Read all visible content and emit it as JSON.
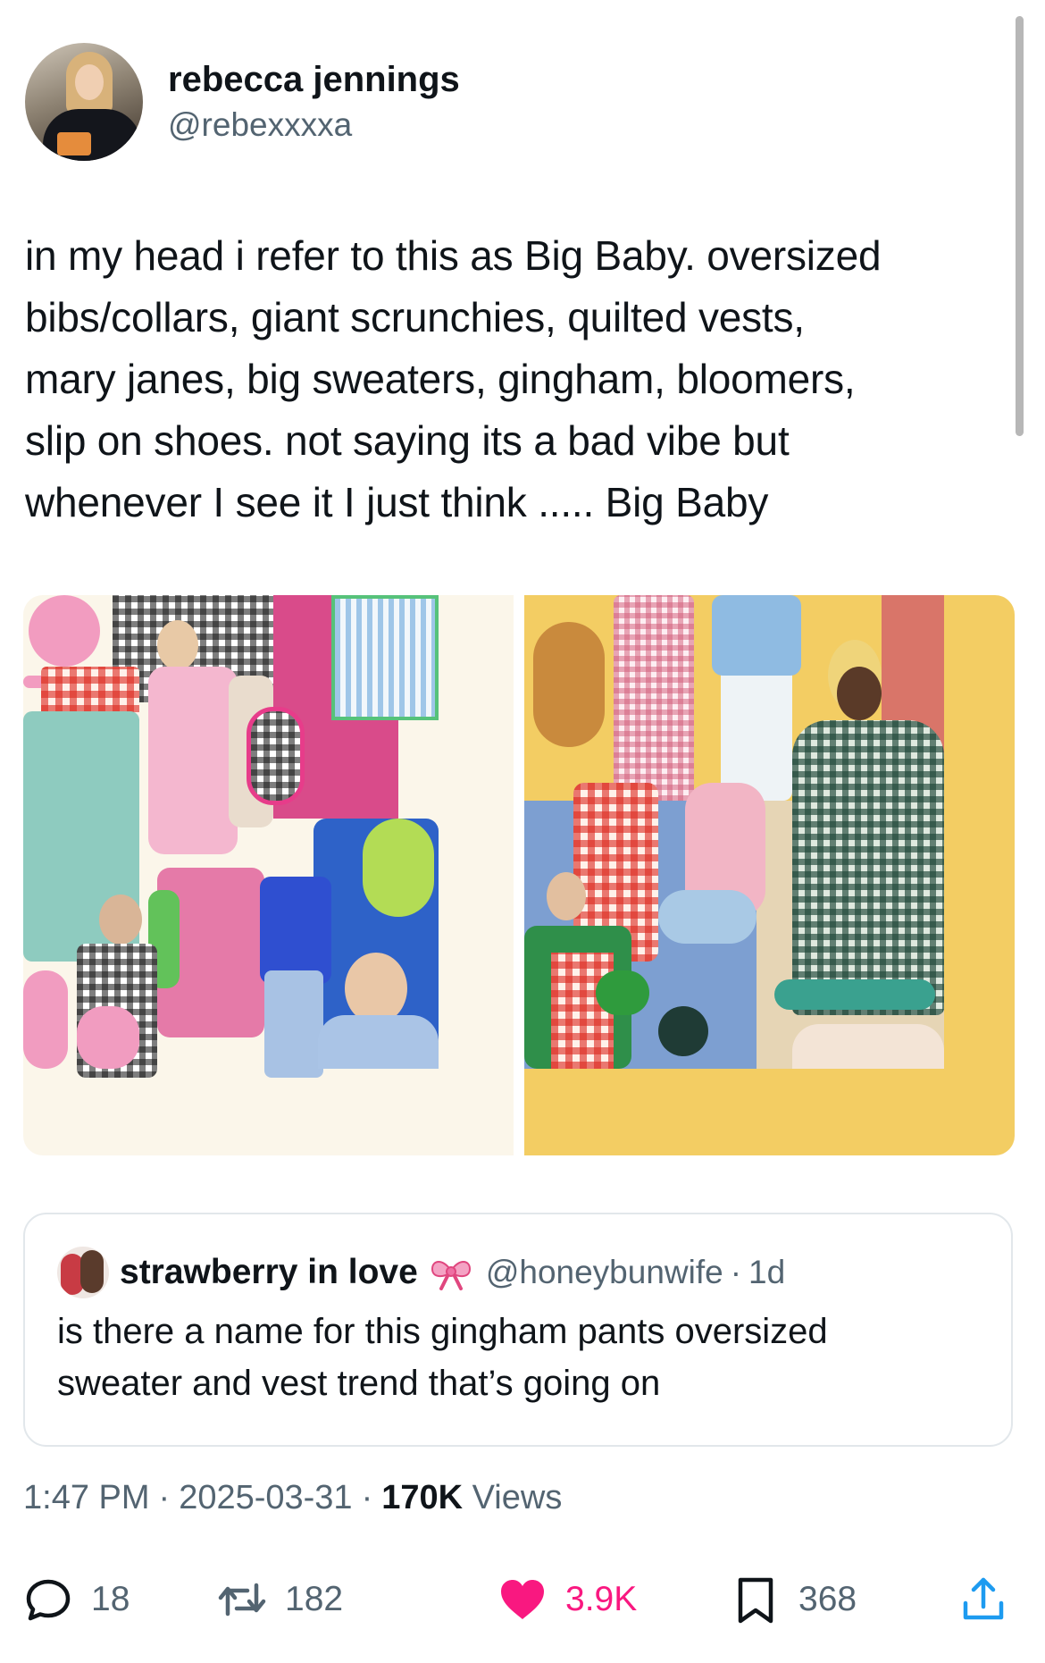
{
  "author": {
    "display_name": "rebecca jennings",
    "handle": "@rebexxxxa"
  },
  "tweet": {
    "text": "in my head i refer to this as Big Baby. oversized\nbibs/collars, giant scrunchies, quilted vests,\nmary janes, big sweaters, gingham, bloomers,\nslip on shoes. not saying its a bad vibe but\nwhenever I see it I just think ..... Big Baby"
  },
  "quoted_tweet": {
    "display_name": "strawberry in love",
    "badge_icon": "bow-icon",
    "handle": "@honeybunwife",
    "separator": "·",
    "time": "1d",
    "text": "is there a name for this gingham pants oversized\nsweater and vest trend that’s going on"
  },
  "meta": {
    "time": "1:47 PM",
    "date": "2025-03-31",
    "views_count": "170K",
    "views_label": "Views",
    "separator": "·"
  },
  "actions": {
    "reply_count": "18",
    "retweet_count": "182",
    "like_count": "3.9K",
    "bookmark_count": "368"
  },
  "colors": {
    "like": "#f91880",
    "secondary_text": "#536471"
  }
}
